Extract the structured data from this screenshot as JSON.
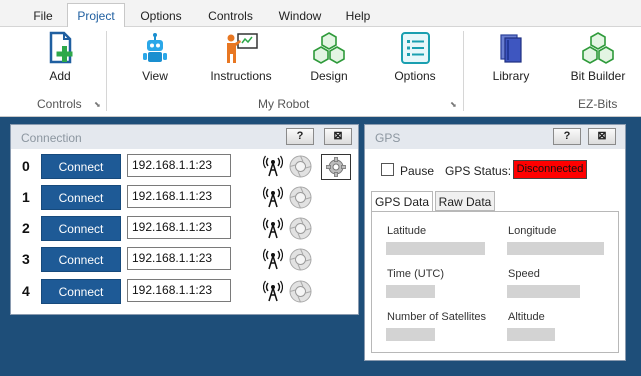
{
  "menu": {
    "items": [
      "File",
      "Project",
      "Options",
      "Controls",
      "Window",
      "Help"
    ],
    "active": "Project"
  },
  "ribbon": {
    "controls_group": {
      "label": "Controls",
      "add": "Add"
    },
    "robot_group": {
      "label": "My Robot",
      "view": "View",
      "instructions": "Instructions",
      "design": "Design",
      "options": "Options"
    },
    "ezbits_group": {
      "label": "EZ-Bits",
      "library": "Library",
      "bit_builder": "Bit Builder"
    }
  },
  "connection": {
    "title": "Connection",
    "help_button": "?",
    "close_button": "⊠",
    "connect_label": "Connect",
    "rows": [
      {
        "index": "0",
        "address": "192.168.1.1:23"
      },
      {
        "index": "1",
        "address": "192.168.1.1:23"
      },
      {
        "index": "2",
        "address": "192.168.1.1:23"
      },
      {
        "index": "3",
        "address": "192.168.1.1:23"
      },
      {
        "index": "4",
        "address": "192.168.1.1:23"
      }
    ]
  },
  "gps": {
    "title": "GPS",
    "help_button": "?",
    "close_button": "⊠",
    "pause_label": "Pause",
    "pause_checked": false,
    "status_label": "GPS Status:",
    "status_value": "Disconnected",
    "status_color": "#ff0000",
    "tabs": [
      "GPS Data",
      "Raw Data"
    ],
    "active_tab": "GPS Data",
    "fields": {
      "latitude": "Latitude",
      "longitude": "Longitude",
      "time": "Time (UTC)",
      "speed": "Speed",
      "satellites": "Number of Satellites",
      "altitude": "Altitude"
    }
  },
  "colors": {
    "accent": "#1e5a96",
    "background": "#1e4e79",
    "icon_blue": "#1f6fbf",
    "icon_green": "#3aa43a",
    "icon_teal": "#1a9fb0"
  }
}
